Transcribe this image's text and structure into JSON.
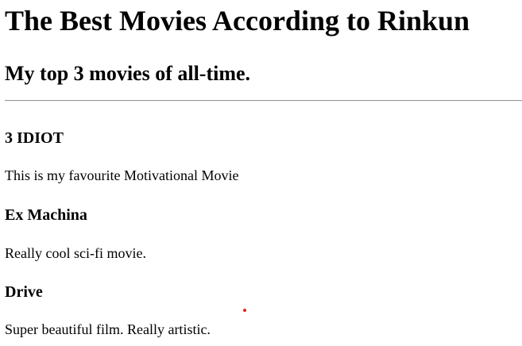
{
  "page": {
    "title": "The Best Movies According to Rinkun",
    "subtitle": "My top 3 movies of all-time."
  },
  "movies": [
    {
      "title": "3 IDIOT",
      "description": "This is my favourite Motivational Movie"
    },
    {
      "title": "Ex Machina",
      "description": "Really cool sci-fi movie."
    },
    {
      "title": "Drive",
      "description": "Super beautiful film. Really artistic."
    }
  ],
  "colors": {
    "text": "#000000",
    "background": "#ffffff",
    "rule": "#9a9a9a",
    "cursor_dot": "#e02020"
  }
}
